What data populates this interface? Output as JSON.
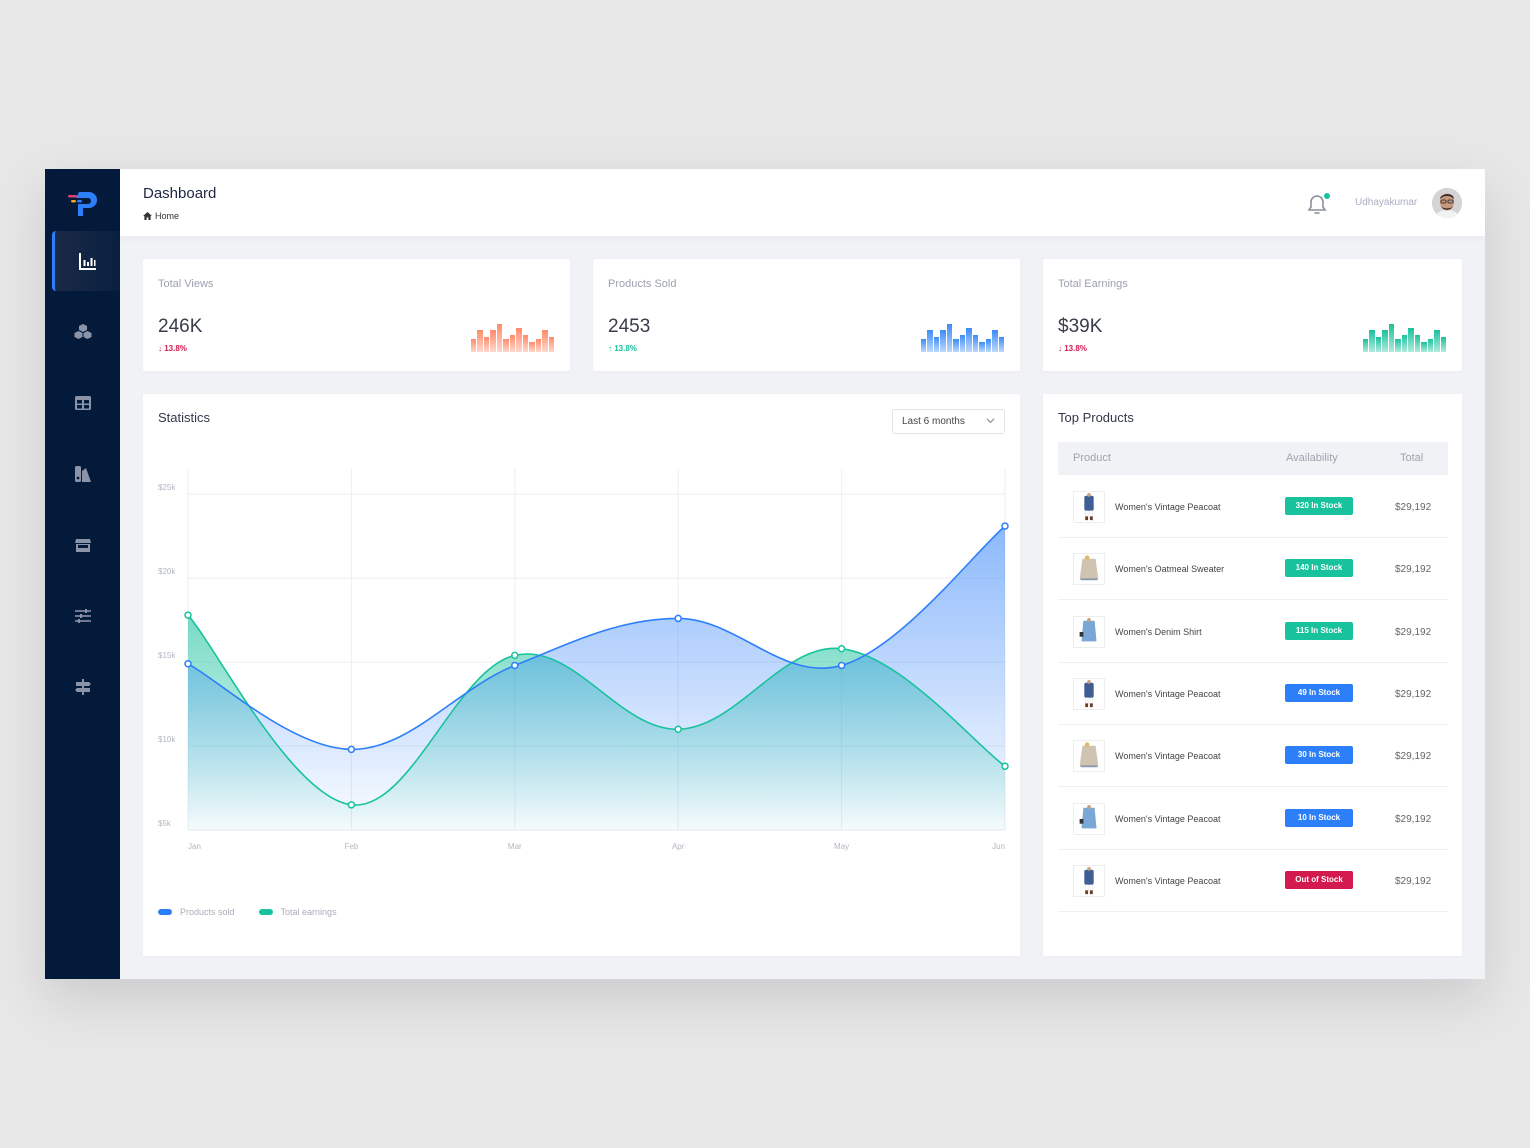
{
  "header": {
    "title": "Dashboard",
    "breadcrumb": "Home",
    "username": "Udhayakumar"
  },
  "sidebar": {
    "items": [
      {
        "icon": "bar-chart-icon",
        "active": true
      },
      {
        "icon": "cubes-icon",
        "active": false
      },
      {
        "icon": "table-icon",
        "active": false
      },
      {
        "icon": "swatches-icon",
        "active": false
      },
      {
        "icon": "store-icon",
        "active": false
      },
      {
        "icon": "sliders-icon",
        "active": false
      },
      {
        "icon": "signpost-icon",
        "active": false
      }
    ]
  },
  "colors": {
    "primary": "#2d7ff9",
    "teal": "#18c29c",
    "red": "#d21a4e",
    "coral": "#ff8a6a",
    "sidebar": "#041a3a"
  },
  "stats": [
    {
      "label": "Total Views",
      "value": "246K",
      "change": "13.8%",
      "direction": "down",
      "spark": [
        0.45,
        0.72,
        0.5,
        0.72,
        0.95,
        0.45,
        0.58,
        0.8,
        0.58,
        0.32,
        0.45,
        0.72,
        0.5
      ],
      "color": "#ff8a6a"
    },
    {
      "label": "Products Sold",
      "value": "2453",
      "change": "13.8%",
      "direction": "up",
      "spark": [
        0.45,
        0.72,
        0.5,
        0.72,
        0.95,
        0.45,
        0.58,
        0.8,
        0.58,
        0.32,
        0.45,
        0.72,
        0.5
      ],
      "color": "#3b8cf7"
    },
    {
      "label": "Total Earnings",
      "value": "$39K",
      "change": "13.8%",
      "direction": "down",
      "spark": [
        0.45,
        0.72,
        0.5,
        0.72,
        0.95,
        0.45,
        0.58,
        0.8,
        0.58,
        0.32,
        0.45,
        0.72,
        0.5
      ],
      "color": "#18c29c"
    }
  ],
  "statistics": {
    "title": "Statistics",
    "range": "Last 6 months"
  },
  "chart_data": {
    "type": "area",
    "title": "Statistics",
    "x": [
      "Jan",
      "Feb",
      "Mar",
      "Apr",
      "May",
      "Jun"
    ],
    "yticks": [
      "$5k",
      "$10k",
      "$15k",
      "$20k",
      "$25k"
    ],
    "ytick_values": [
      5000,
      10000,
      15000,
      20000,
      25000
    ],
    "ylim": [
      5000,
      26500
    ],
    "grid": true,
    "legend_position": "bottom-left",
    "series": [
      {
        "name": "Products sold",
        "color": "#2d7ff9",
        "values": [
          14900,
          9800,
          14800,
          17600,
          14800,
          23100
        ]
      },
      {
        "name": "Total earnings",
        "color": "#18c29c",
        "values": [
          17800,
          6500,
          15400,
          11000,
          15800,
          8800
        ]
      }
    ]
  },
  "top_products": {
    "title": "Top Products",
    "columns": [
      "Product",
      "Availability",
      "Total"
    ],
    "rows": [
      {
        "name": "Women's Vintage Peacoat",
        "availability": "320 In Stock",
        "status": "high",
        "total": "$29,192",
        "thumb": "peacoat"
      },
      {
        "name": "Women's Oatmeal Sweater",
        "availability": "140 In Stock",
        "status": "high",
        "total": "$29,192",
        "thumb": "sweater"
      },
      {
        "name": "Women's Denim Shirt",
        "availability": "115 In Stock",
        "status": "high",
        "total": "$29,192",
        "thumb": "denim"
      },
      {
        "name": "Women's Vintage Peacoat",
        "availability": "49 In Stock",
        "status": "low",
        "total": "$29,192",
        "thumb": "peacoat"
      },
      {
        "name": "Women's Vintage Peacoat",
        "availability": "30 In Stock",
        "status": "low",
        "total": "$29,192",
        "thumb": "sweater"
      },
      {
        "name": "Women's Vintage Peacoat",
        "availability": "10 In Stock",
        "status": "low",
        "total": "$29,192",
        "thumb": "denim"
      },
      {
        "name": "Women's Vintage Peacoat",
        "availability": "Out of Stock",
        "status": "out",
        "total": "$29,192",
        "thumb": "peacoat"
      }
    ]
  }
}
